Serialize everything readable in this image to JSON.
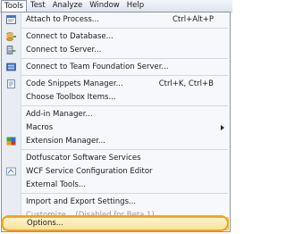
{
  "menubar": {
    "items": [
      {
        "label": "Tools",
        "active": true
      },
      {
        "label": "Test"
      },
      {
        "label": "Analyze"
      },
      {
        "label": "Window"
      },
      {
        "label": "Help"
      }
    ]
  },
  "menu": {
    "items": [
      {
        "label": "Attach to Process...",
        "shortcut": "Ctrl+Alt+P",
        "icon": "attach-process-icon"
      },
      {
        "label": "Connect to Database...",
        "icon": "database-icon"
      },
      {
        "label": "Connect to Server...",
        "icon": "server-icon"
      },
      {
        "label": "Connect to Team Foundation Server...",
        "icon": "team-server-icon"
      },
      {
        "label": "Code Snippets Manager...",
        "shortcut": "Ctrl+K, Ctrl+B",
        "icon": "snippets-icon"
      },
      {
        "label": "Choose Toolbox Items..."
      },
      {
        "label": "Add-in Manager..."
      },
      {
        "label": "Macros",
        "submenu": true
      },
      {
        "label": "Extension Manager...",
        "icon": "extension-icon"
      },
      {
        "label": "Dotfuscator Software Services"
      },
      {
        "label": "WCF Service Configuration Editor"
      },
      {
        "label": "External Tools..."
      },
      {
        "label": "Import and Export Settings..."
      },
      {
        "label": "Customize... (Disabled for Beta 1)",
        "disabled": true
      },
      {
        "label": "Options...",
        "highlighted": true
      }
    ]
  },
  "colors": {
    "highlight_border": "#f2a21a",
    "menu_background": "#f7f8fb"
  }
}
